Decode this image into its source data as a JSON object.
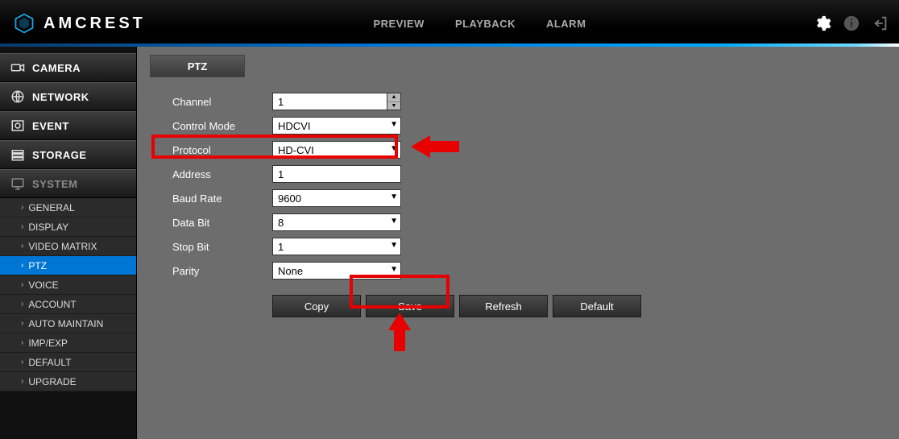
{
  "brand": "AMCREST",
  "top_nav": {
    "preview": "PREVIEW",
    "playback": "PLAYBACK",
    "alarm": "ALARM"
  },
  "sidebar": {
    "camera": "CAMERA",
    "network": "NETWORK",
    "event": "EVENT",
    "storage": "STORAGE",
    "system": "SYSTEM",
    "subs": {
      "general": "GENERAL",
      "display": "DISPLAY",
      "video_matrix": "VIDEO MATRIX",
      "ptz": "PTZ",
      "voice": "VOICE",
      "account": "ACCOUNT",
      "auto_maintain": "AUTO MAINTAIN",
      "imp_exp": "IMP/EXP",
      "default": "DEFAULT",
      "upgrade": "UPGRADE"
    }
  },
  "tabs": {
    "ptz": "PTZ"
  },
  "form": {
    "channel": {
      "label": "Channel",
      "value": "1"
    },
    "control_mode": {
      "label": "Control Mode",
      "value": "HDCVI"
    },
    "protocol": {
      "label": "Protocol",
      "value": "HD-CVI"
    },
    "address": {
      "label": "Address",
      "value": "1"
    },
    "baud_rate": {
      "label": "Baud Rate",
      "value": "9600"
    },
    "data_bit": {
      "label": "Data Bit",
      "value": "8"
    },
    "stop_bit": {
      "label": "Stop Bit",
      "value": "1"
    },
    "parity": {
      "label": "Parity",
      "value": "None"
    }
  },
  "buttons": {
    "copy": "Copy",
    "save": "Save",
    "refresh": "Refresh",
    "default": "Default"
  }
}
